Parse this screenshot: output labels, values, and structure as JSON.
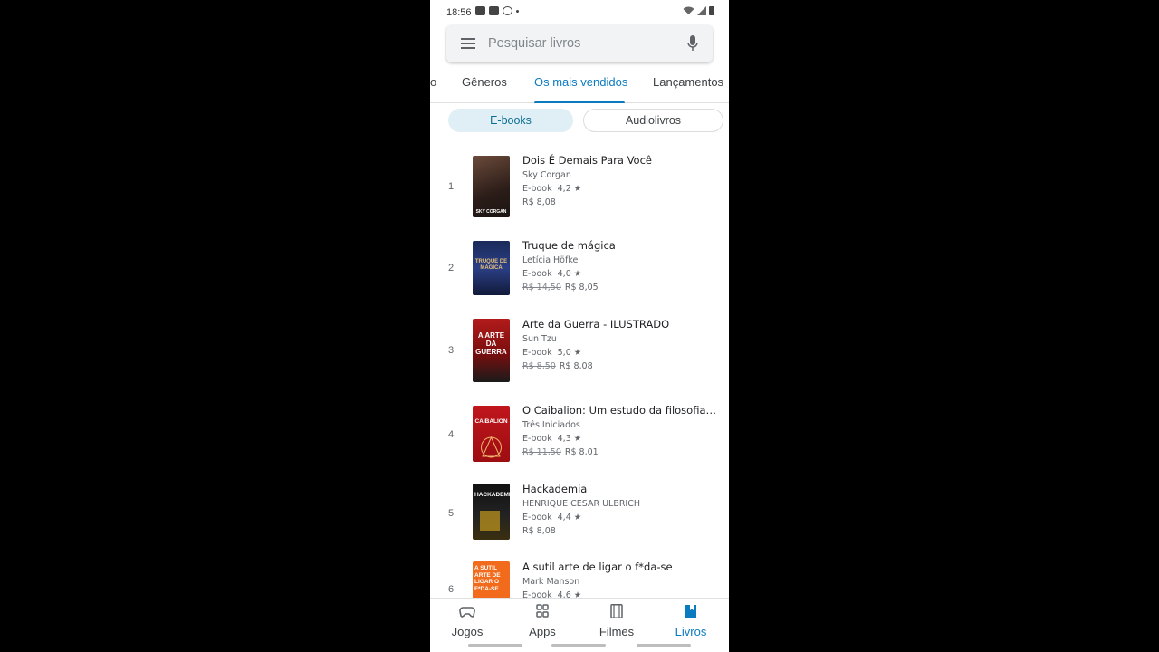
{
  "status_bar": {
    "time": "18:56"
  },
  "search": {
    "placeholder": "Pesquisar livros"
  },
  "tabs": [
    {
      "label": "o"
    },
    {
      "label": "Gêneros"
    },
    {
      "label": "Os mais vendidos"
    },
    {
      "label": "Lançamentos"
    }
  ],
  "filters": {
    "ebooks": "E-books",
    "audiobooks": "Audiolivros"
  },
  "books": [
    {
      "rank": "1",
      "title": "Dois É Demais Para Você",
      "author": "Sky Corgan",
      "format": "E-book",
      "rating": "4,2 ★",
      "old_price": "",
      "price": "R$ 8,08",
      "cover_text": "SKY CORGAN"
    },
    {
      "rank": "2",
      "title": "Truque de mágica",
      "author": "Letícia Höfke",
      "format": "E-book",
      "rating": "4,0 ★",
      "old_price": "R$ 14,50",
      "price": "R$ 8,05",
      "cover_text": "TRUQUE DE MÁGICA"
    },
    {
      "rank": "3",
      "title": "Arte da Guerra - ILUSTRADO",
      "author": "Sun Tzu",
      "format": "E-book",
      "rating": "5,0 ★",
      "old_price": "R$ 8,50",
      "price": "R$ 8,08",
      "cover_text": "A ARTE DA GUERRA"
    },
    {
      "rank": "4",
      "title": "O Caibalion: Um estudo da filosofia he...",
      "author": "Três Iniciados",
      "format": "E-book",
      "rating": "4,3 ★",
      "old_price": "R$ 11,50",
      "price": "R$ 8,01",
      "cover_text": "CAIBALION"
    },
    {
      "rank": "5",
      "title": "Hackademia",
      "author": "HENRIQUE CESAR ULBRICH",
      "format": "E-book",
      "rating": "4,4 ★",
      "old_price": "",
      "price": "R$ 8,08",
      "cover_text": "HACKADEMIA"
    },
    {
      "rank": "6",
      "title": "A sutil arte de ligar o f*da-se",
      "author": "Mark Manson",
      "format": "E-book",
      "rating": "4,6 ★",
      "old_price": "",
      "price": "",
      "cover_text": "A SUTIL ARTE DE LIGAR O F*DA-SE"
    }
  ],
  "bottom_nav": {
    "games": "Jogos",
    "apps": "Apps",
    "movies": "Filmes",
    "books": "Livros"
  },
  "colors": {
    "accent": "#0b7bbf",
    "chip_selected_bg": "#e0eff5"
  }
}
